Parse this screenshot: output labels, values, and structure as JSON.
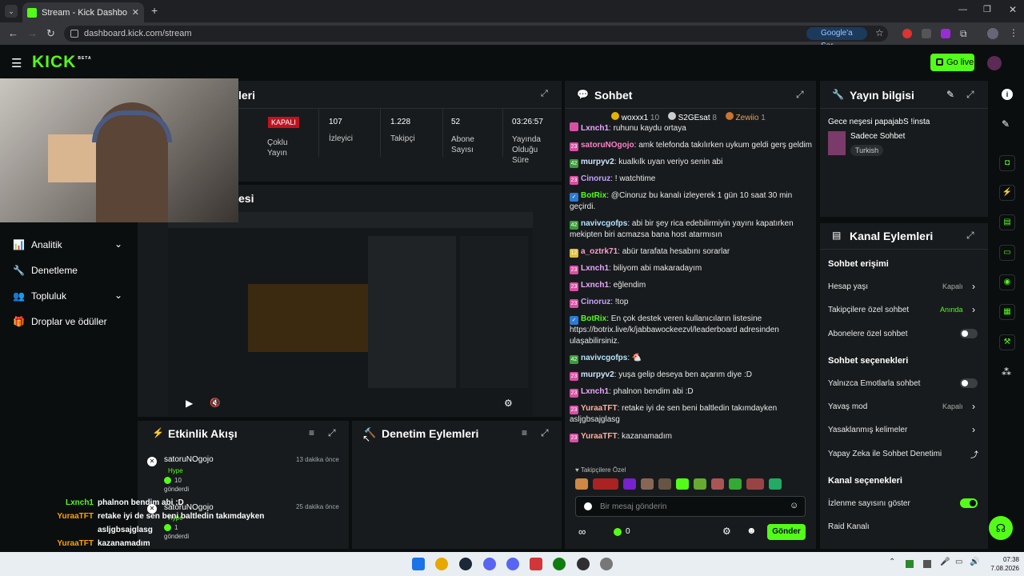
{
  "browser": {
    "tab_title": "Stream - Kick Dashboard",
    "url": "dashboard.kick.com/stream",
    "google_sor": "Google'a Sor"
  },
  "kick": {
    "logo": "KICK",
    "beta": "BETA",
    "go_live": "Go live"
  },
  "stats": {
    "title_partial": "leri",
    "status": "KAPALI",
    "multi": "Çoklu Yayın",
    "viewers_val": "107",
    "viewers_lbl": "İzleyici",
    "followers_val": "1.228",
    "followers_lbl": "Takipçi",
    "subs_val": "52",
    "subs_lbl": "Abone Sayısı",
    "time_val": "03:26:57",
    "time_lbl": "Yayında Olduğu Süre"
  },
  "preview": {
    "title_partial": "esi"
  },
  "sidebar": {
    "items": [
      {
        "label": "Analitik"
      },
      {
        "label": "Denetleme"
      },
      {
        "label": "Topluluk"
      },
      {
        "label": "Droplar ve ödüller"
      }
    ]
  },
  "activity": {
    "title": "Etkinlik Akışı",
    "events": [
      {
        "user": "satoruNOgojo",
        "time": "13 dakika önce",
        "type": "Hype",
        "amount": "10",
        "sent": "gönderdi"
      },
      {
        "user": "satoruNOgojo",
        "time": "25 dakika önce",
        "type": "Hype",
        "amount": "1",
        "sent": "gönderdi"
      }
    ]
  },
  "moderation": {
    "title": "Denetim Eylemleri"
  },
  "overlay_chat": [
    {
      "user": "Lxnch1",
      "text": "phalnon bendim abi :D"
    },
    {
      "user": "YuraaTFT",
      "text": "retake iyi de sen beni baltledin takımdayken"
    },
    {
      "user": "",
      "text": "asljgbsajglasg"
    },
    {
      "user": "YuraaTFT",
      "text": "kazanamadım"
    }
  ],
  "chat": {
    "title": "Sohbet",
    "top": [
      {
        "name": "woxxx1",
        "val": "10"
      },
      {
        "name": "S2GEsat",
        "val": "8"
      },
      {
        "name": "Zewiio",
        "val": "1"
      }
    ],
    "messages": [
      {
        "badge": "",
        "user": "Lxnch1",
        "text": "ruhunu kaydu ortaya",
        "color": "#e9a8ff"
      },
      {
        "badge": "23",
        "user": "satoruNOgojo",
        "text": "amk telefonda takılırken uykum geldi gerş geldim",
        "color": "#ff80c8"
      },
      {
        "badge": "42",
        "user": "murpyv2",
        "text": "kualkılk uyan veriyo senin abi",
        "color": "#cde6ff"
      },
      {
        "badge": "23",
        "user": "Cinoruz",
        "text": "! watchtime",
        "color": "#c4a3ff"
      },
      {
        "badge": "bot",
        "user": "BotRix",
        "text": "@Cinoruz bu kanalı izleyerek 1 gün 10 saat 30 min geçirdi.",
        "color": "#53fc18"
      },
      {
        "badge": "42",
        "user": "navivcgofps",
        "text": "abi bir şey rica edebilirmiyin yayını kapatırken mekipten biri acmazsa bana host atarmısın",
        "color": "#b4e4ff"
      },
      {
        "badge": "12",
        "user": "a_oztrk71",
        "text": "abür tarafata hesabını sorarlar",
        "color": "#ff9fd0"
      },
      {
        "badge": "23",
        "user": "Lxnch1",
        "text": "biliyom abi makaradayım",
        "color": "#e9a8ff"
      },
      {
        "badge": "23",
        "user": "Lxnch1",
        "text": "eğlendim",
        "color": "#e9a8ff"
      },
      {
        "badge": "23",
        "user": "Cinoruz",
        "text": "!top",
        "color": "#c4a3ff"
      },
      {
        "badge": "bot",
        "user": "BotRix",
        "text": "En çok destek veren kullanıcıların listesine https://botrix.live/k/jabbawockeezvl/leaderboard adresinden ulaşabilirsiniz.",
        "color": "#53fc18"
      },
      {
        "badge": "42",
        "user": "navivcgofps",
        "text": "🐔",
        "color": "#b4e4ff"
      },
      {
        "badge": "23",
        "user": "murpyv2",
        "text": "yuşa gelip deseya ben açarım diye :D",
        "color": "#cde6ff"
      },
      {
        "badge": "23",
        "user": "Lxnch1",
        "text": "phalnon bendim abi :D",
        "color": "#e9a8ff"
      },
      {
        "badge": "23",
        "user": "YuraaTFT",
        "text": "retake iyi de sen beni baltledin takımdayken asljgbsajglasg",
        "color": "#ffb0a0"
      },
      {
        "badge": "23",
        "user": "YuraaTFT",
        "text": "kazanamadım",
        "color": "#ffb0a0"
      }
    ],
    "followers_only": "Takipçilere Özel",
    "placeholder": "Bir mesaj gönderin",
    "points": "0",
    "send": "Gönder"
  },
  "stream_info": {
    "title": "Yayın bilgisi",
    "stream_title": "Gece neşesi papajabS !insta",
    "category": "Sadece Sohbet",
    "tag": "Turkish"
  },
  "channel_actions": {
    "title": "Kanal Eylemleri",
    "chat_access": "Sohbet erişimi",
    "account_age": "Hesap yaşı",
    "account_age_val": "Kapalı",
    "followers_chat": "Takipçilere özel sohbet",
    "followers_chat_val": "Anında",
    "subs_chat": "Abonelere özel sohbet",
    "chat_options": "Sohbet seçenekleri",
    "emotes_only": "Yalnızca Emotlarla sohbet",
    "slow_mode": "Yavaş mod",
    "slow_mode_val": "Kapalı",
    "banned_words": "Yasaklanmış kelimeler",
    "ai_mod": "Yapay Zeka ile Sohbet Denetimi",
    "channel_options": "Kanal seçenekleri",
    "show_views": "İzlenme sayısını göster",
    "raid": "Raid Kanalı"
  },
  "clock": {
    "time": "07:38",
    "date": "7.08.2026"
  }
}
